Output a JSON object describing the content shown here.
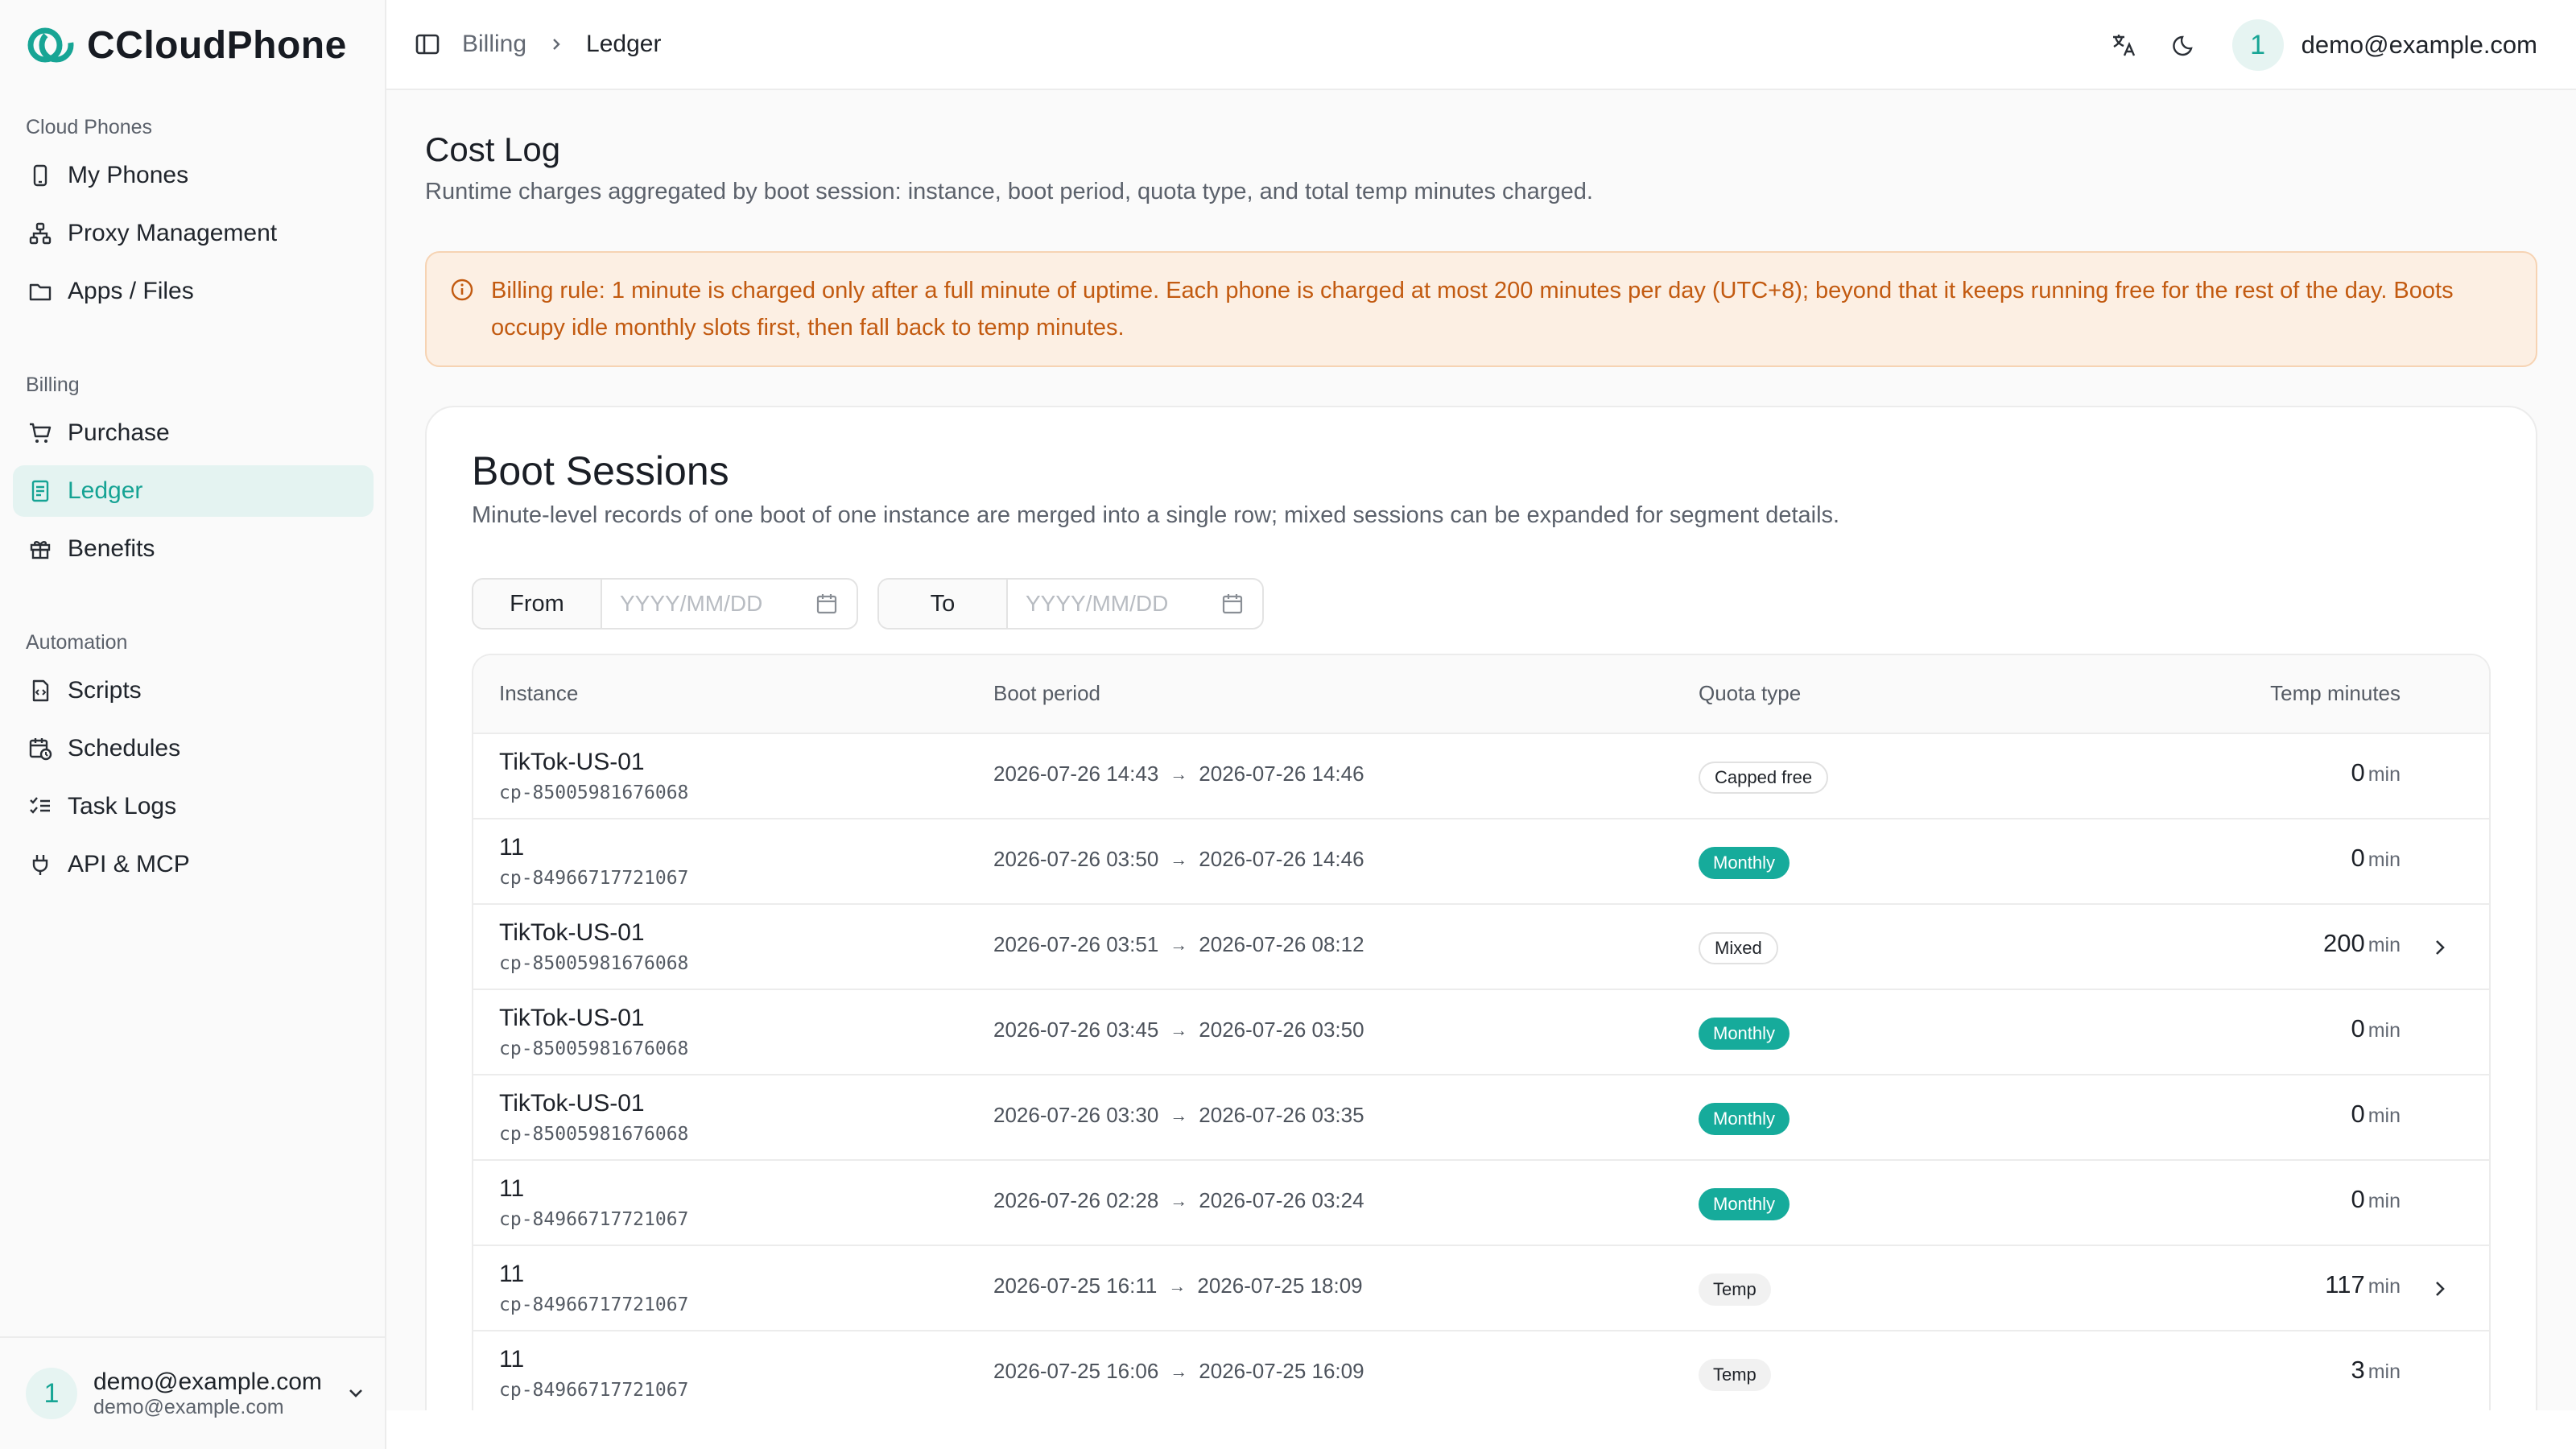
{
  "app": {
    "name": "CCloudPhone"
  },
  "sidebar": {
    "groups": [
      {
        "label": "Cloud Phones",
        "items": [
          {
            "label": "My Phones",
            "icon": "phone-icon"
          },
          {
            "label": "Proxy Management",
            "icon": "network-icon"
          },
          {
            "label": "Apps / Files",
            "icon": "folder-icon"
          }
        ]
      },
      {
        "label": "Billing",
        "items": [
          {
            "label": "Purchase",
            "icon": "cart-icon"
          },
          {
            "label": "Ledger",
            "icon": "ledger-icon",
            "active": true
          },
          {
            "label": "Benefits",
            "icon": "gift-icon"
          }
        ]
      },
      {
        "label": "Automation",
        "items": [
          {
            "label": "Scripts",
            "icon": "script-icon"
          },
          {
            "label": "Schedules",
            "icon": "calendar-clock-icon"
          },
          {
            "label": "Task Logs",
            "icon": "checklist-icon"
          },
          {
            "label": "API & MCP",
            "icon": "plug-icon"
          }
        ]
      }
    ],
    "user": {
      "avatar": "1",
      "name": "demo@example.com",
      "email": "demo@example.com"
    }
  },
  "topbar": {
    "breadcrumb": [
      "Billing",
      "Ledger"
    ],
    "avatar": "1",
    "email": "demo@example.com"
  },
  "page": {
    "title": "Cost Log",
    "subtitle": "Runtime charges aggregated by boot session: instance, boot period, quota type, and total temp minutes charged.",
    "notice": "Billing rule: 1 minute is charged only after a full minute of uptime. Each phone is charged at most 200 minutes per day (UTC+8); beyond that it keeps running free for the rest of the day. Boots occupy idle monthly slots first, then fall back to temp minutes."
  },
  "sessions": {
    "title": "Boot Sessions",
    "subtitle": "Minute-level records of one boot of one instance are merged into a single row; mixed sessions can be expanded for segment details.",
    "from_label": "From",
    "to_label": "To",
    "date_placeholder": "YYYY/MM/DD",
    "columns": {
      "instance": "Instance",
      "period": "Boot period",
      "quota": "Quota type",
      "temp": "Temp minutes"
    },
    "unit": "min",
    "arrow": "→",
    "rows": [
      {
        "name": "TikTok-US-01",
        "id": "cp-85005981676068",
        "start": "2026-07-26 14:43",
        "end": "2026-07-26 14:46",
        "quota": "Capped free",
        "style": "outline",
        "temp": "0",
        "expand": false
      },
      {
        "name": "11",
        "id": "cp-84966717721067",
        "start": "2026-07-26 03:50",
        "end": "2026-07-26 14:46",
        "quota": "Monthly",
        "style": "teal",
        "temp": "0",
        "expand": false
      },
      {
        "name": "TikTok-US-01",
        "id": "cp-85005981676068",
        "start": "2026-07-26 03:51",
        "end": "2026-07-26 08:12",
        "quota": "Mixed",
        "style": "outline",
        "temp": "200",
        "expand": true
      },
      {
        "name": "TikTok-US-01",
        "id": "cp-85005981676068",
        "start": "2026-07-26 03:45",
        "end": "2026-07-26 03:50",
        "quota": "Monthly",
        "style": "teal",
        "temp": "0",
        "expand": false
      },
      {
        "name": "TikTok-US-01",
        "id": "cp-85005981676068",
        "start": "2026-07-26 03:30",
        "end": "2026-07-26 03:35",
        "quota": "Monthly",
        "style": "teal",
        "temp": "0",
        "expand": false
      },
      {
        "name": "11",
        "id": "cp-84966717721067",
        "start": "2026-07-26 02:28",
        "end": "2026-07-26 03:24",
        "quota": "Monthly",
        "style": "teal",
        "temp": "0",
        "expand": false
      },
      {
        "name": "11",
        "id": "cp-84966717721067",
        "start": "2026-07-25 16:11",
        "end": "2026-07-25 18:09",
        "quota": "Temp",
        "style": "gray",
        "temp": "117",
        "expand": true
      },
      {
        "name": "11",
        "id": "cp-84966717721067",
        "start": "2026-07-25 16:06",
        "end": "2026-07-25 16:09",
        "quota": "Temp",
        "style": "gray",
        "temp": "3",
        "expand": false
      }
    ]
  },
  "colors": {
    "accent": "#16ab9b",
    "notice_bg": "#fcefe3",
    "notice_text": "#c25a10"
  }
}
